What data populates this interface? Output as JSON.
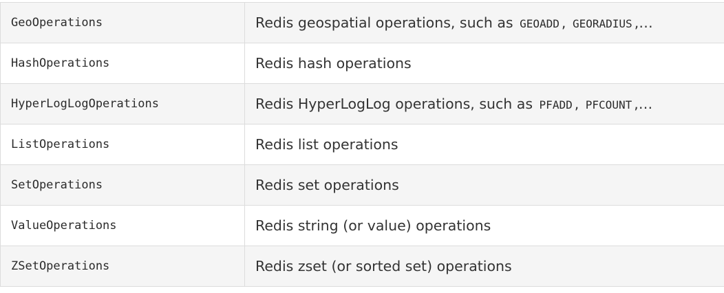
{
  "table": {
    "rows": [
      {
        "name": "GeoOperations",
        "desc_prefix": "Redis geospatial operations, such as ",
        "code1": "GEOADD",
        "sep": ",",
        "code2": "GEORADIUS",
        "ellipsis": ",…"
      },
      {
        "name": "HashOperations",
        "desc": "Redis hash operations"
      },
      {
        "name": "HyperLogLogOperations",
        "desc_prefix": "Redis HyperLogLog operations, such as ",
        "code1": "PFADD",
        "sep": ",",
        "code2": "PFCOUNT",
        "ellipsis": ",…"
      },
      {
        "name": "ListOperations",
        "desc": "Redis list operations"
      },
      {
        "name": "SetOperations",
        "desc": "Redis set operations"
      },
      {
        "name": "ValueOperations",
        "desc": "Redis string (or value) operations"
      },
      {
        "name": "ZSetOperations",
        "desc": "Redis zset (or sorted set) operations"
      }
    ]
  }
}
